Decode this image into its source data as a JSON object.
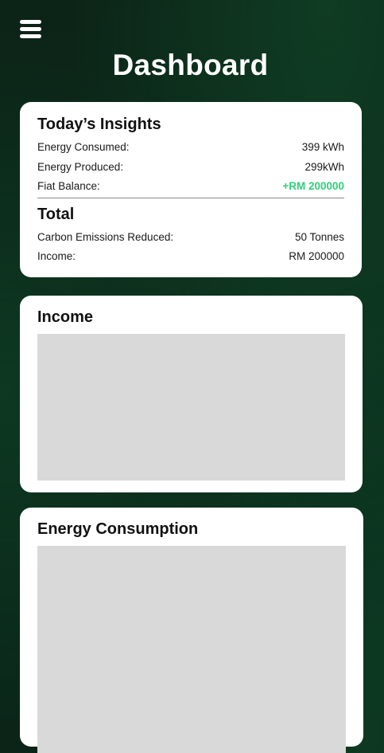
{
  "header": {
    "title": "Dashboard",
    "menu_icon": "hamburger-menu-icon"
  },
  "insights": {
    "heading": "Today’s Insights",
    "rows": [
      {
        "label": "Energy Consumed:",
        "value": "399 kWh"
      },
      {
        "label": "Energy Produced:",
        "value": "299kWh"
      },
      {
        "label": "Fiat Balance:",
        "value": "+RM 200000"
      }
    ],
    "total_heading": "Total",
    "total_rows": [
      {
        "label": "Carbon Emissions Reduced:",
        "value": "50 Tonnes"
      },
      {
        "label": "Income:",
        "value": "RM 200000"
      }
    ]
  },
  "income": {
    "heading": "Income"
  },
  "energy": {
    "heading": "Energy Consumption"
  },
  "colors": {
    "positive": "#2fd07a",
    "placeholder": "#d9d9d9",
    "card": "#ffffff"
  }
}
